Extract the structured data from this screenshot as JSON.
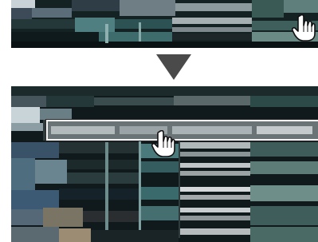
{
  "figure": {
    "panels": [
      {
        "name": "before-screen",
        "cursor_icon": "hand-pointer-icon"
      },
      {
        "name": "after-screen",
        "cursor_icon": "hand-pointer-icon",
        "highlight": "selected-row-outline"
      }
    ],
    "transition_icon": "down-triangle-icon",
    "colors": {
      "background": "#ffffff",
      "arrow": "#4a4a4a",
      "highlight_border": "#f4f4f4",
      "screen_dark": "#0f1a1c",
      "screen_teal": "#4f7f80"
    }
  }
}
